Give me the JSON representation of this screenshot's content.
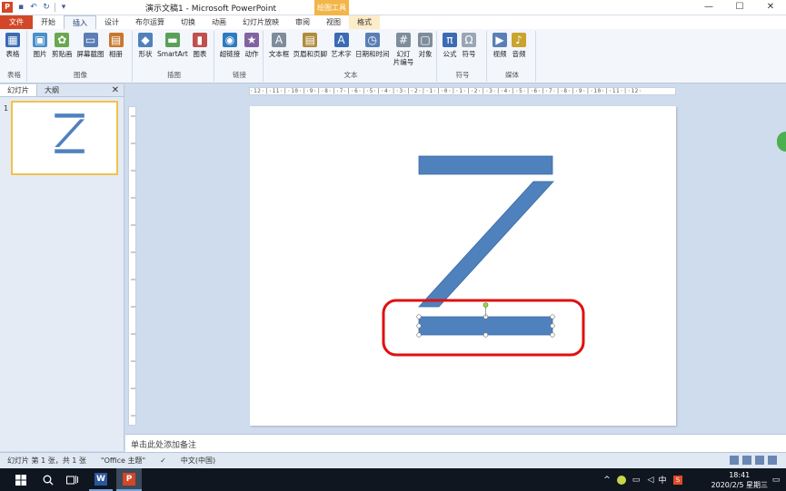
{
  "app": {
    "title": "演示文稿1 - Microsoft PowerPoint",
    "context_group": "绘图工具"
  },
  "tabs": [
    "文件",
    "开始",
    "插入",
    "设计",
    "布尔运算",
    "切换",
    "动画",
    "幻灯片放映",
    "审阅",
    "视图",
    "格式"
  ],
  "active_tab": "插入",
  "ribbon": {
    "groups": [
      {
        "label": "表格",
        "buttons": [
          {
            "label": "表格",
            "icon": "table-icon",
            "color": "#3b6bb3"
          }
        ]
      },
      {
        "label": "图像",
        "buttons": [
          {
            "label": "图片",
            "icon": "picture-icon",
            "color": "#4a8fc9"
          },
          {
            "label": "剪贴画",
            "icon": "clipart-icon",
            "color": "#6aa84f"
          },
          {
            "label": "屏幕截图",
            "icon": "screenshot-icon",
            "color": "#5b7fb5"
          },
          {
            "label": "相册",
            "icon": "album-icon",
            "color": "#c9772e"
          }
        ]
      },
      {
        "label": "插图",
        "buttons": [
          {
            "label": "形状",
            "icon": "shapes-icon",
            "color": "#4f81bd"
          },
          {
            "label": "SmartArt",
            "icon": "smartart-icon",
            "color": "#5aa05a"
          },
          {
            "label": "图表",
            "icon": "chart-icon",
            "color": "#c0504d"
          }
        ]
      },
      {
        "label": "链接",
        "buttons": [
          {
            "label": "超链接",
            "icon": "hyperlink-icon",
            "color": "#2e7bbf"
          },
          {
            "label": "动作",
            "icon": "action-icon",
            "color": "#8064a2"
          }
        ]
      },
      {
        "label": "文本",
        "buttons": [
          {
            "label": "文本框",
            "icon": "textbox-icon",
            "color": "#7f8c9c"
          },
          {
            "label": "页眉和页脚",
            "icon": "header-footer-icon",
            "color": "#b08d3c"
          },
          {
            "label": "艺术字",
            "icon": "wordart-icon",
            "color": "#3b6bb3"
          },
          {
            "label": "日期和时间",
            "icon": "datetime-icon",
            "color": "#5b7fb5"
          },
          {
            "label": "幻灯\n片编号",
            "icon": "slide-number-icon",
            "color": "#7f8c9c"
          },
          {
            "label": "对象",
            "icon": "object-icon",
            "color": "#7f8c9c"
          }
        ]
      },
      {
        "label": "符号",
        "buttons": [
          {
            "label": "公式",
            "icon": "equation-icon",
            "color": "#3b6bb3"
          },
          {
            "label": "符号",
            "icon": "symbol-icon",
            "color": "#9aa6b6"
          }
        ]
      },
      {
        "label": "媒体",
        "buttons": [
          {
            "label": "视频",
            "icon": "video-icon",
            "color": "#5b7fb5"
          },
          {
            "label": "音频",
            "icon": "audio-icon",
            "color": "#c9a42e"
          }
        ]
      }
    ]
  },
  "left_pane": {
    "tabs": [
      "幻灯片",
      "大纲"
    ],
    "slide_number": "1"
  },
  "ruler_text": "·12·|·11·|·10·|·9·|·8·|·7·|·6·|·5·|·4·|·3·|·2·|·1·|·0·|·1·|·2·|·3·|·4·|·5·|·6·|·7·|·8·|·9·|·10·|·11·|·12·",
  "slide": {
    "shape_color": "#4f81bd",
    "highlight_color": "#e01010"
  },
  "notes_placeholder": "单击此处添加备注",
  "status": {
    "slide_info": "幻灯片 第 1 张，共 1 张",
    "theme": "\"Office 主题\"",
    "language": "中文(中国)"
  },
  "taskbar": {
    "time": "18:41",
    "date": "2020/2/5 星期三",
    "ime": "中"
  }
}
